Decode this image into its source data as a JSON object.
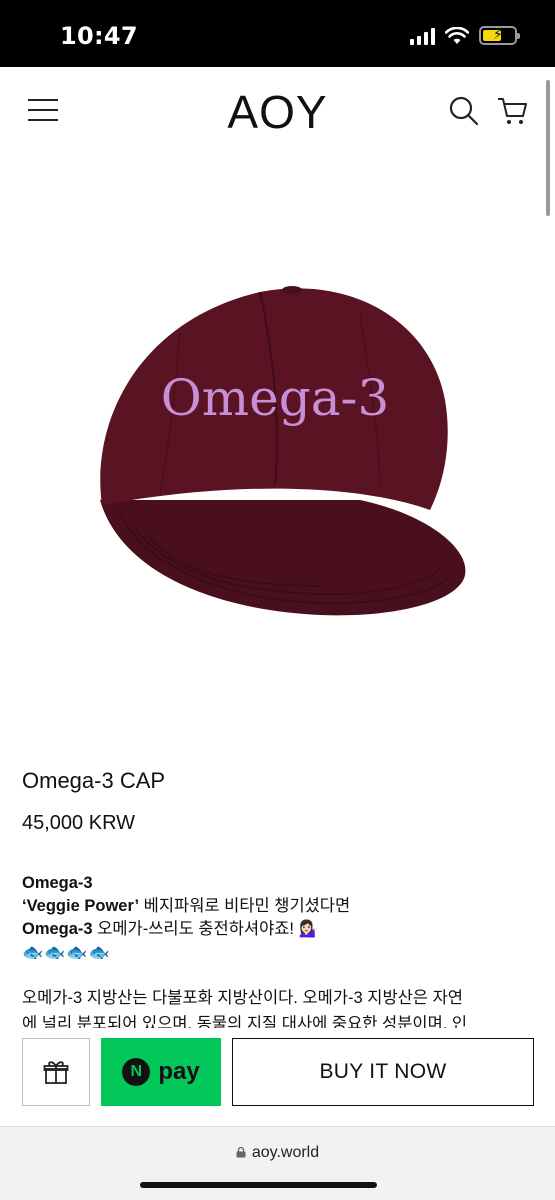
{
  "status_bar": {
    "time": "10:47"
  },
  "header": {
    "logo": "AOY"
  },
  "product": {
    "image_text": "Omega-3",
    "title": "Omega-3 CAP",
    "price": "45,000 KRW"
  },
  "description": {
    "line1": "Omega-3",
    "line2_bold": "‘Veggie Power’",
    "line2_rest": " 베지파워로 비타민 챙기셨다면",
    "line3_bold": "Omega-3",
    "line3_rest": " 오메가-쓰리도 충전하셔야죠! 💁🏻‍♀️",
    "line4": "🐟🐟🐟🐟",
    "para1": "오메가-3 지방산는 다불포화 지방산이다. 오메가-3 지방산은 자연",
    "para2": "에 널리 분포되어 있으며, 동물의 지질 대사에 중요한 성분이며, 인"
  },
  "buy_bar": {
    "npay_n": "N",
    "npay_label": "pay",
    "buy_now_label": "BUY IT NOW"
  },
  "browser": {
    "url": "aoy.world"
  },
  "colors": {
    "cap": "#5a1322",
    "embroidery": "#c88fd6",
    "npay_green": "#03c75a"
  }
}
